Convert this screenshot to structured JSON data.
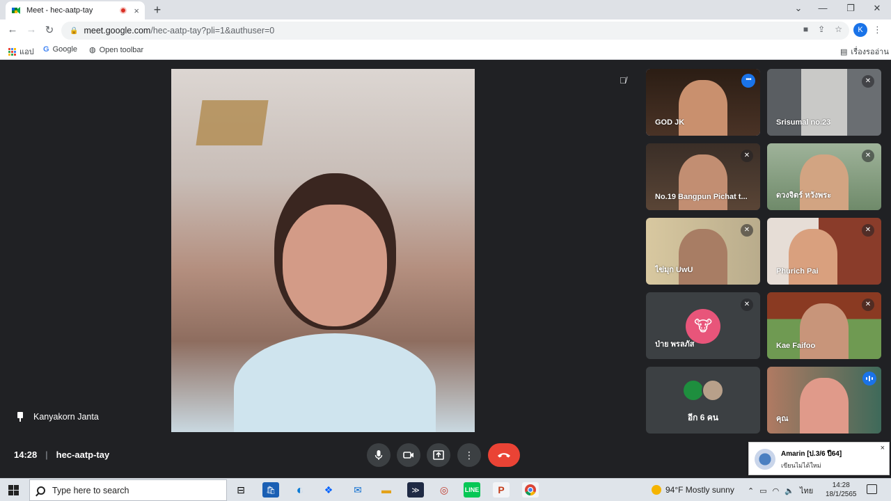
{
  "browser": {
    "tab_title": "Meet - hec-aatp-tay",
    "tab_close": "×",
    "new_tab": "+",
    "url_host": "meet.google.com",
    "url_path": "/hec-aatp-tay?pli=1&authuser=0",
    "profile_initial": "K",
    "bookmarks": [
      {
        "label": "แอป"
      },
      {
        "label": "Google"
      },
      {
        "label": "Open toolbar"
      }
    ],
    "reading_list": "เรื่องรออ่าน"
  },
  "meet": {
    "pinned_participant": "Kanyakorn Janta",
    "time": "14:28",
    "meeting_code": "hec-aatp-tay",
    "participants": [
      {
        "name": "GOD JK",
        "mic": "more",
        "active": true,
        "color": "#6b4a3a"
      },
      {
        "name": "Srisumal no.23",
        "mic": "muted",
        "color": "#9a9d9f"
      },
      {
        "name": "No.19 Bangpun Pichat t...",
        "mic": "muted",
        "color": "#4a3b32"
      },
      {
        "name": "ดวงจิตร์ หวังพระ",
        "mic": "muted",
        "color": "#8fa184"
      },
      {
        "name": "ไข่มุก UwU",
        "mic": "muted",
        "color": "#c9b48a"
      },
      {
        "name": "Phurich Pai",
        "mic": "muted",
        "color": "#9a5a3b"
      },
      {
        "name": "ป่าย พรลภัส",
        "mic": "muted",
        "avatar": true,
        "color": "#3c4043"
      },
      {
        "name": "Kae Faifoo",
        "mic": "muted",
        "color": "#6f8d55"
      },
      {
        "name": "อีก 6 คน",
        "more": true,
        "color": "#3c4043"
      },
      {
        "name": "คุณ",
        "mic": "speaking",
        "color": "#b06f5a"
      }
    ]
  },
  "notification": {
    "title": "Amarin [ป.3/6 ปี64]",
    "body": "เขียนไม่ได้ใหม่",
    "close": "×"
  },
  "taskbar": {
    "search_placeholder": "Type here to search",
    "weather": "94°F  Mostly sunny",
    "language": "ไทย",
    "clock_time": "14:28",
    "clock_date": "18/1/2565"
  }
}
